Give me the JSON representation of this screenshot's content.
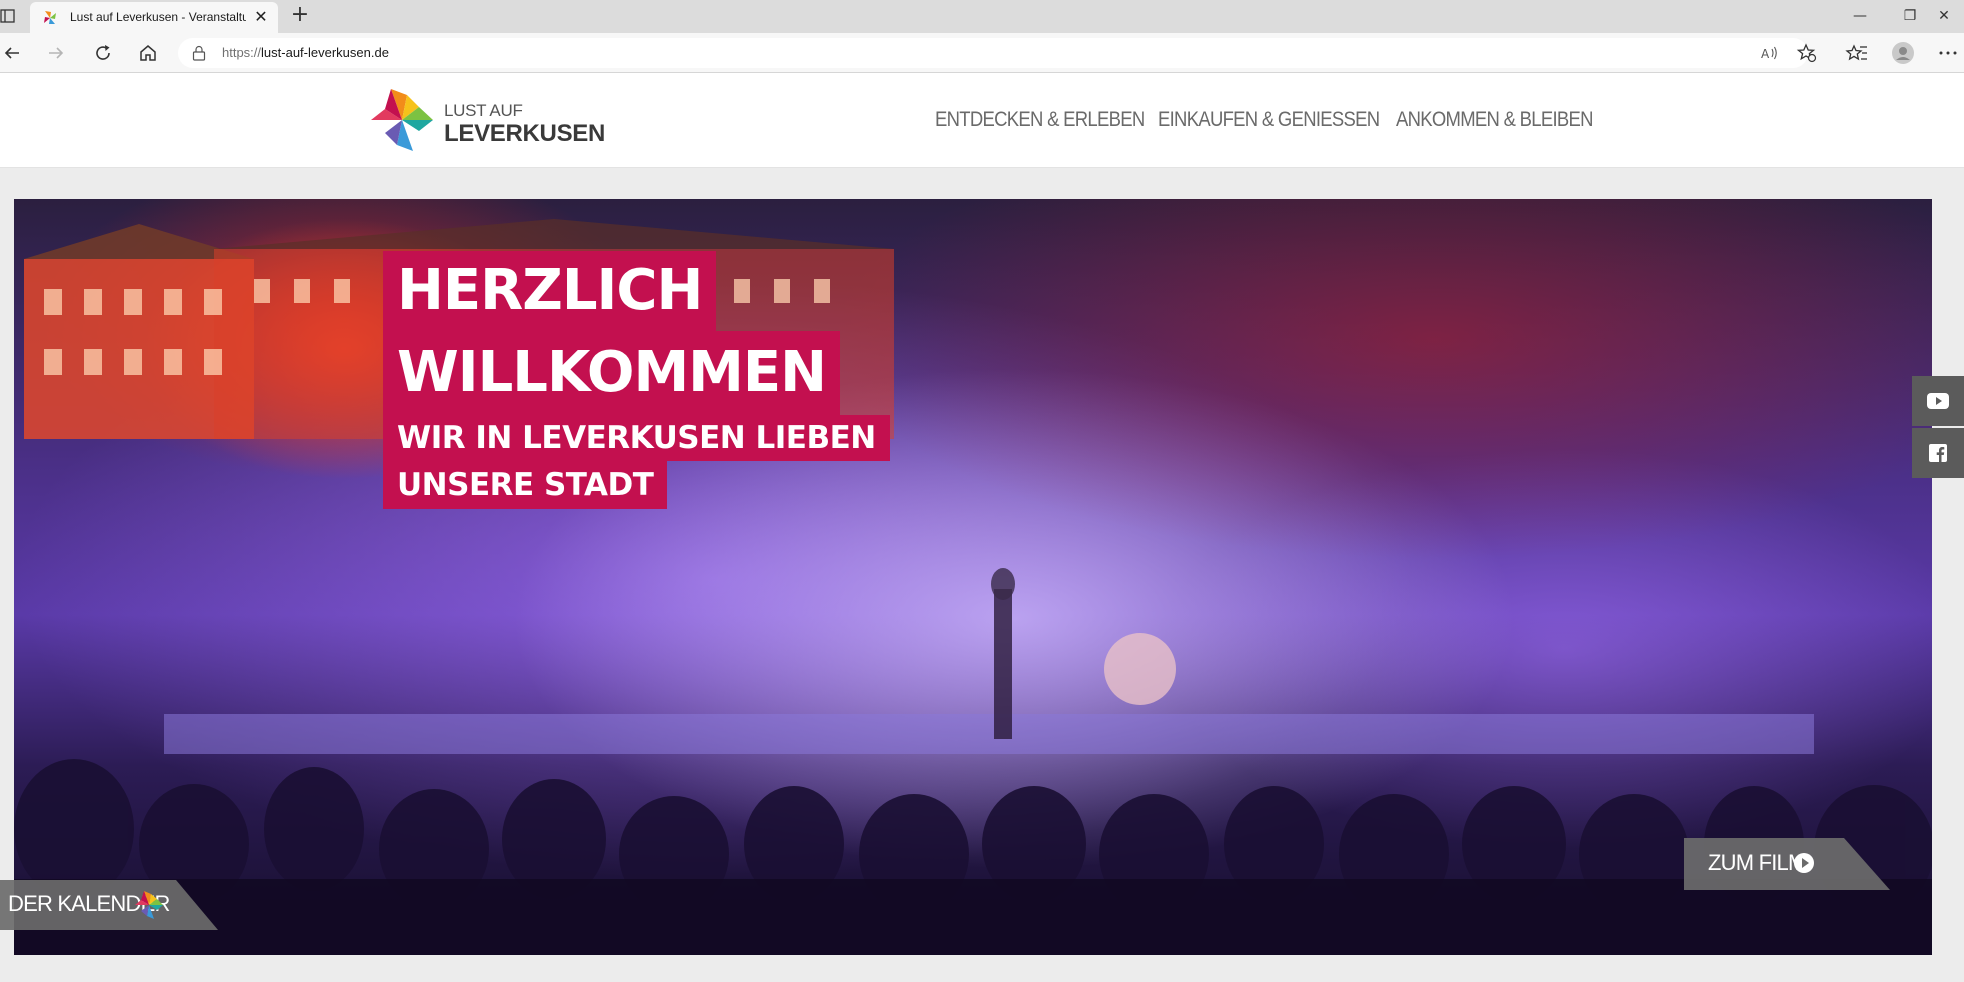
{
  "browser": {
    "tab": {
      "title": "Lust auf Leverkusen - Veranstaltu",
      "close_label": "✕"
    },
    "new_tab_label": "+",
    "window_controls": {
      "minimize": "—",
      "restore": "❐",
      "close": "✕"
    },
    "url": {
      "scheme": "https://",
      "host": "lust-auf-leverkusen.de"
    },
    "icons": [
      "back-icon",
      "forward-icon",
      "reload-icon",
      "home-icon",
      "lock-icon",
      "read-aloud-icon",
      "add-favorite-icon",
      "favorites-icon",
      "profile-icon",
      "more-icon"
    ]
  },
  "site": {
    "logo": {
      "line1": "LUST AUF",
      "line2": "LEVERKUSEN"
    },
    "nav": [
      {
        "label": "ENTDECKEN & ERLEBEN"
      },
      {
        "label": "EINKAUFEN & GENIESSEN"
      },
      {
        "label": "ANKOMMEN & BLEIBEN"
      }
    ]
  },
  "hero": {
    "headline_line1": "HERZLICH",
    "headline_line2": "WILLKOMMEN",
    "subline_line1": "WIR IN LEVERKUSEN LIEBEN",
    "subline_line2": "UNSERE STADT",
    "film_button": "ZUM FILM",
    "calendar_button": "DER KALENDER",
    "social": [
      "youtube-icon",
      "facebook-icon"
    ]
  },
  "colors": {
    "brand_magenta": "#c3104f",
    "button_gray": "#6b6b6b",
    "nav_text": "#6a6a6a"
  }
}
